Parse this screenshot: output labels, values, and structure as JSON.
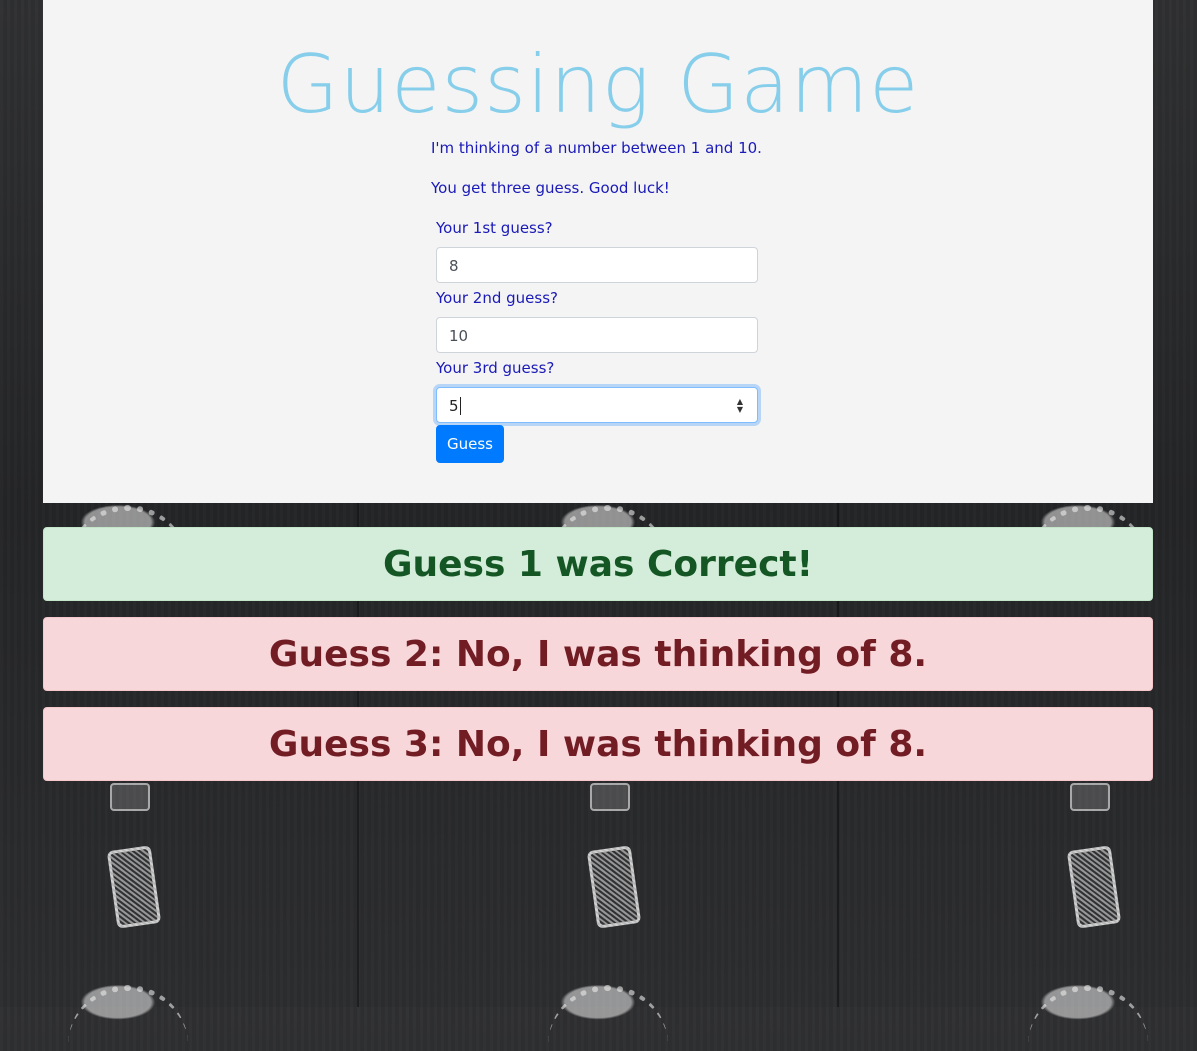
{
  "header": {
    "title": "Guessing Game"
  },
  "intro": {
    "line1": "I'm thinking of a number between 1 and 10.",
    "line2": "You get three guess. Good luck!"
  },
  "form": {
    "guess1": {
      "label": "Your 1st guess?",
      "value": "8"
    },
    "guess2": {
      "label": "Your 2nd guess?",
      "value": "10"
    },
    "guess3": {
      "label": "Your 3rd guess?",
      "value": "5"
    },
    "submit_label": "Guess"
  },
  "results": [
    {
      "text": "Guess 1 was Correct!",
      "status": "success"
    },
    {
      "text": "Guess 2: No, I was thinking of 8.",
      "status": "danger"
    },
    {
      "text": "Guess 3: No, I was thinking of 8.",
      "status": "danger"
    }
  ],
  "colors": {
    "title": "#87ceeb",
    "text": "#1a1ab8",
    "button": "#007bff",
    "success_bg": "#d4edda",
    "danger_bg": "#f8d7da"
  }
}
